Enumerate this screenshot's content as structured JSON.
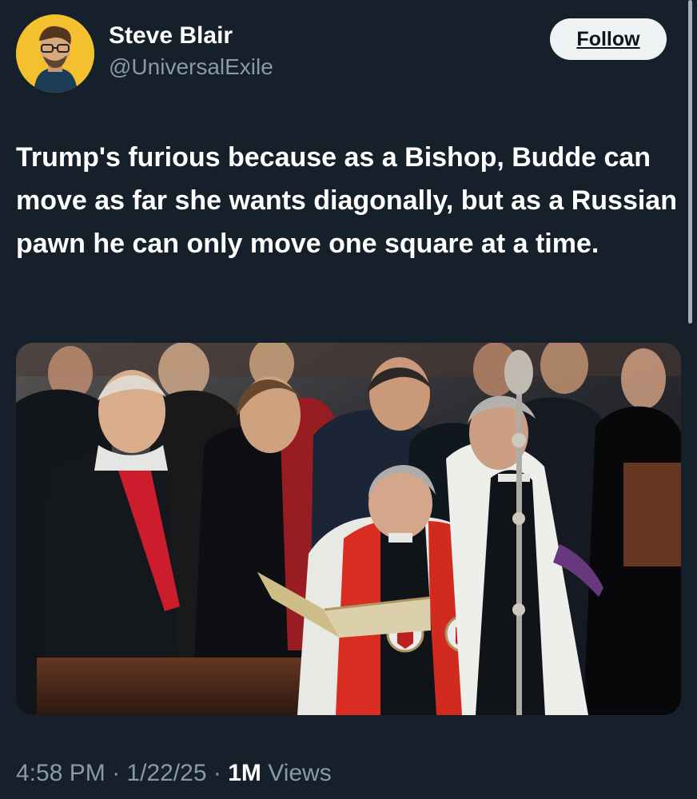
{
  "author": {
    "display_name": "Steve Blair",
    "handle": "@UniversalExile"
  },
  "actions": {
    "follow_label": "Follow"
  },
  "tweet": {
    "text": "Trump's furious because as a Bishop, Budde can move as far she wants diagonally, but as a Russian pawn he can only move one square at a time."
  },
  "meta": {
    "time": "4:58 PM",
    "separator": "·",
    "date": "1/22/25",
    "views_count": "1M",
    "views_label": "Views"
  },
  "icons": {
    "avatar": "person-avatar-image",
    "media": "ceremony-photo"
  },
  "colors": {
    "background": "#15202b",
    "primary_text": "#ffffff",
    "secondary_text": "#8b98a5",
    "follow_button": "#eff3f4"
  }
}
